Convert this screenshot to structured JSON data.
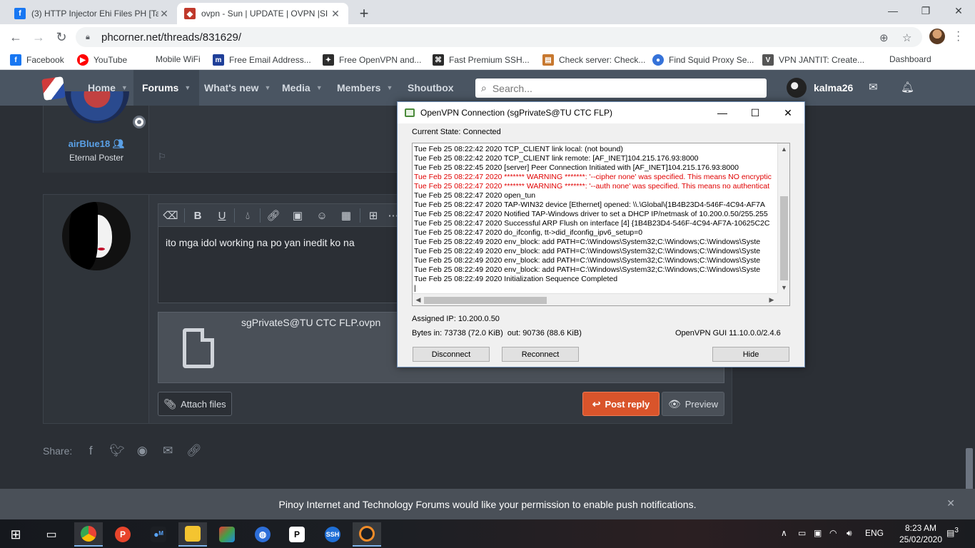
{
  "browser": {
    "tabs": [
      {
        "title": "(3) HTTP Injector Ehi Files PH [Ta",
        "favicon": "facebook-icon",
        "color": "#1877f2"
      },
      {
        "title": "ovpn - Sun | UPDATE | OVPN |SI",
        "favicon": "phcorner-icon",
        "color": "#c0392b"
      }
    ],
    "url": "phcorner.net/threads/831629/",
    "bookmarks": [
      {
        "label": "Facebook",
        "icon": "facebook-icon",
        "color": "#1877f2",
        "glyph": "f"
      },
      {
        "label": "YouTube",
        "icon": "youtube-icon",
        "color": "#ff0000",
        "glyph": "▶"
      },
      {
        "label": "Mobile WiFi",
        "icon": "",
        "color": "",
        "glyph": ""
      },
      {
        "label": "Free Email Address...",
        "icon": "mail-logo-icon",
        "color": "#1f3f99",
        "glyph": "m"
      },
      {
        "label": "Free OpenVPN and...",
        "icon": "vpn-star-icon",
        "color": "#2d2d2d",
        "glyph": "✦"
      },
      {
        "label": "Fast Premium SSH...",
        "icon": "ssh-icon",
        "color": "#2b2b2b",
        "glyph": "⌘"
      },
      {
        "label": "Check server: Check...",
        "icon": "server-icon",
        "color": "#c7782f",
        "glyph": "▤"
      },
      {
        "label": "Find Squid Proxy Se...",
        "icon": "squid-icon",
        "color": "#3572d9",
        "glyph": "●"
      },
      {
        "label": "VPN JANTIT: Create...",
        "icon": "vpn-icon",
        "color": "#555555",
        "glyph": "V"
      },
      {
        "label": "Dashboard",
        "icon": "",
        "color": "",
        "glyph": ""
      }
    ]
  },
  "forum": {
    "nav": [
      {
        "label": "Home",
        "active": false
      },
      {
        "label": "Forums",
        "active": true
      },
      {
        "label": "What's new",
        "active": false
      },
      {
        "label": "Media",
        "active": false
      },
      {
        "label": "Members",
        "active": false
      },
      {
        "label": "Shoutbox",
        "active": false
      }
    ],
    "search_placeholder": "Search...",
    "username": "kalma26",
    "post1": {
      "author": "airBlue18",
      "title": "Eternal Poster"
    },
    "editor_text": "ito mga idol working na po yan inedit ko na",
    "attachment": "sgPrivateS@TU CTC FLP.ovpn",
    "buttons": {
      "attach": "Attach files",
      "post": "Post reply",
      "preview": "Preview"
    },
    "share_label": "Share:",
    "notification": "Pinoy Internet and Technology Forums would like your permission to enable push notifications."
  },
  "vpn": {
    "title": "OpenVPN Connection (sgPrivateS@TU CTC FLP)",
    "state": "Current State: Connected",
    "log": [
      {
        "text": "Tue Feb 25 08:22:42 2020 TCP_CLIENT link local: (not bound)",
        "warn": false
      },
      {
        "text": "Tue Feb 25 08:22:42 2020 TCP_CLIENT link remote: [AF_INET]104.215.176.93:8000",
        "warn": false
      },
      {
        "text": "Tue Feb 25 08:22:45 2020 [server] Peer Connection Initiated with [AF_INET]104.215.176.93:8000",
        "warn": false
      },
      {
        "text": "Tue Feb 25 08:22:47 2020 ******* WARNING *******: '--cipher none' was specified. This means NO encryptic",
        "warn": true
      },
      {
        "text": "Tue Feb 25 08:22:47 2020 ******* WARNING *******: '--auth none' was specified. This means no authenticat",
        "warn": true
      },
      {
        "text": "Tue Feb 25 08:22:47 2020 open_tun",
        "warn": false
      },
      {
        "text": "Tue Feb 25 08:22:47 2020 TAP-WIN32 device [Ethernet] opened: \\\\.\\Global\\{1B4B23D4-546F-4C94-AF7A",
        "warn": false
      },
      {
        "text": "Tue Feb 25 08:22:47 2020 Notified TAP-Windows driver to set a DHCP IP/netmask of 10.200.0.50/255.255",
        "warn": false
      },
      {
        "text": "Tue Feb 25 08:22:47 2020 Successful ARP Flush on interface [4] {1B4B23D4-546F-4C94-AF7A-10625C2C",
        "warn": false
      },
      {
        "text": "Tue Feb 25 08:22:47 2020 do_ifconfig, tt->did_ifconfig_ipv6_setup=0",
        "warn": false
      },
      {
        "text": "Tue Feb 25 08:22:49 2020 env_block: add PATH=C:\\Windows\\System32;C:\\Windows;C:\\Windows\\Syste",
        "warn": false
      },
      {
        "text": "Tue Feb 25 08:22:49 2020 env_block: add PATH=C:\\Windows\\System32;C:\\Windows;C:\\Windows\\Syste",
        "warn": false
      },
      {
        "text": "Tue Feb 25 08:22:49 2020 env_block: add PATH=C:\\Windows\\System32;C:\\Windows;C:\\Windows\\Syste",
        "warn": false
      },
      {
        "text": "Tue Feb 25 08:22:49 2020 env_block: add PATH=C:\\Windows\\System32;C:\\Windows;C:\\Windows\\Syste",
        "warn": false
      },
      {
        "text": "Tue Feb 25 08:22:49 2020 Initialization Sequence Completed",
        "warn": false
      },
      {
        "text": "|",
        "warn": false
      }
    ],
    "assigned_ip": "Assigned IP: 10.200.0.50",
    "bytes": "Bytes in: 73738 (72.0 KiB)  out: 90736 (88.6 KiB)",
    "version": "OpenVPN GUI 11.10.0.0/2.4.6",
    "buttons": {
      "disconnect": "Disconnect",
      "reconnect": "Reconnect",
      "hide": "Hide"
    }
  },
  "taskbar": {
    "lang": "ENG",
    "time": "8:23 AM",
    "date": "25/02/2020",
    "notifications": "3"
  }
}
